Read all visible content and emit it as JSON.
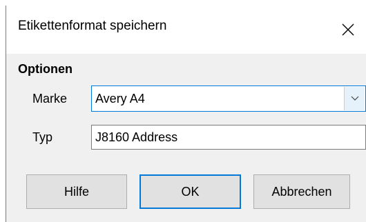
{
  "dialog": {
    "title": "Etikettenformat speichern",
    "close_icon": "close-icon"
  },
  "options": {
    "section_title": "Optionen",
    "brand": {
      "label": "Marke",
      "value": "Avery A4",
      "dropdown_icon": "chevron-down-icon"
    },
    "type": {
      "label": "Typ",
      "value": "J8160 Address"
    }
  },
  "buttons": {
    "help_label": "Hilfe",
    "ok_label": "OK",
    "cancel_label": "Abbrechen"
  },
  "colors": {
    "accent": "#0078d7",
    "dialog_background": "#f0f0f0",
    "titlebar_background": "#ffffff",
    "button_background": "#e1e1e1"
  }
}
